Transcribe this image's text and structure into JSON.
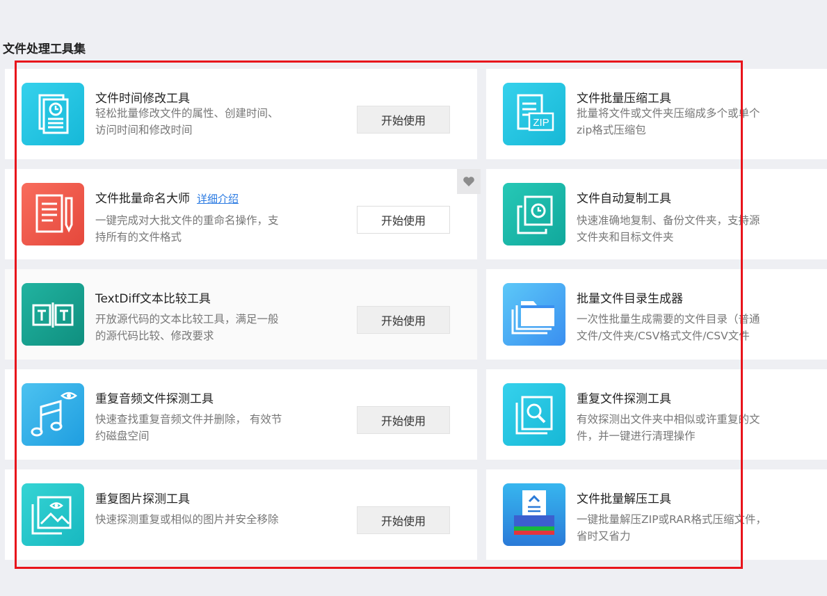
{
  "section": {
    "title": "文件处理工具集"
  },
  "tools": [
    {
      "title": "文件时间修改工具",
      "desc1": "轻松批量修改文件的属性、创建时间、",
      "desc2": "访问时间和修改时间",
      "button": "开始使用",
      "icon": "document-clock-icon"
    },
    {
      "title": "文件批量压缩工具",
      "desc1": "批量将文件或文件夹压缩成多个或单个",
      "desc2": "zip格式压缩包",
      "icon": "zip-file-icon",
      "icon_text": "ZIP"
    },
    {
      "title": "文件批量命名大师",
      "link": "详细介绍",
      "desc1": "一键完成对大批文件的重命名操作，支",
      "desc2": "持所有的文件格式",
      "button": "开始使用",
      "icon": "document-pen-icon"
    },
    {
      "title": "文件自动复制工具",
      "desc1": "快速准确地复制、备份文件夹，支持源",
      "desc2": "文件夹和目标文件夹",
      "icon": "copy-clock-icon"
    },
    {
      "title": "TextDiff文本比较工具",
      "desc1": "开放源代码的文本比较工具，满足一般",
      "desc2": "的源代码比较、修改要求",
      "button": "开始使用",
      "icon": "text-compare-icon"
    },
    {
      "title": "批量文件目录生成器",
      "desc1": "一次性批量生成需要的文件目录（普通",
      "desc2": "文件/文件夹/CSV格式文件/CSV文件",
      "icon": "folder-stack-icon"
    },
    {
      "title": "重复音频文件探测工具",
      "desc1": "快速查找重复音频文件并删除， 有效节",
      "desc2": "约磁盘空间",
      "button": "开始使用",
      "icon": "music-eye-icon"
    },
    {
      "title": "重复文件探测工具",
      "desc1": "有效探测出文件夹中相似或许重复的文",
      "desc2": "件，并一键进行清理操作",
      "icon": "file-search-icon"
    },
    {
      "title": "重复图片探测工具",
      "desc1": "快速探测重复或相似的图片并安全移除",
      "desc2": "",
      "button": "开始使用",
      "icon": "image-eye-icon"
    },
    {
      "title": "文件批量解压工具",
      "desc1": "一键批量解压ZIP或RAR格式压缩文件，",
      "desc2": "省时又省力",
      "icon": "extract-box-icon"
    }
  ],
  "colors": {
    "highlight": "#e8141b",
    "link": "#2a7ae2",
    "page_bg": "#eeeff3"
  }
}
